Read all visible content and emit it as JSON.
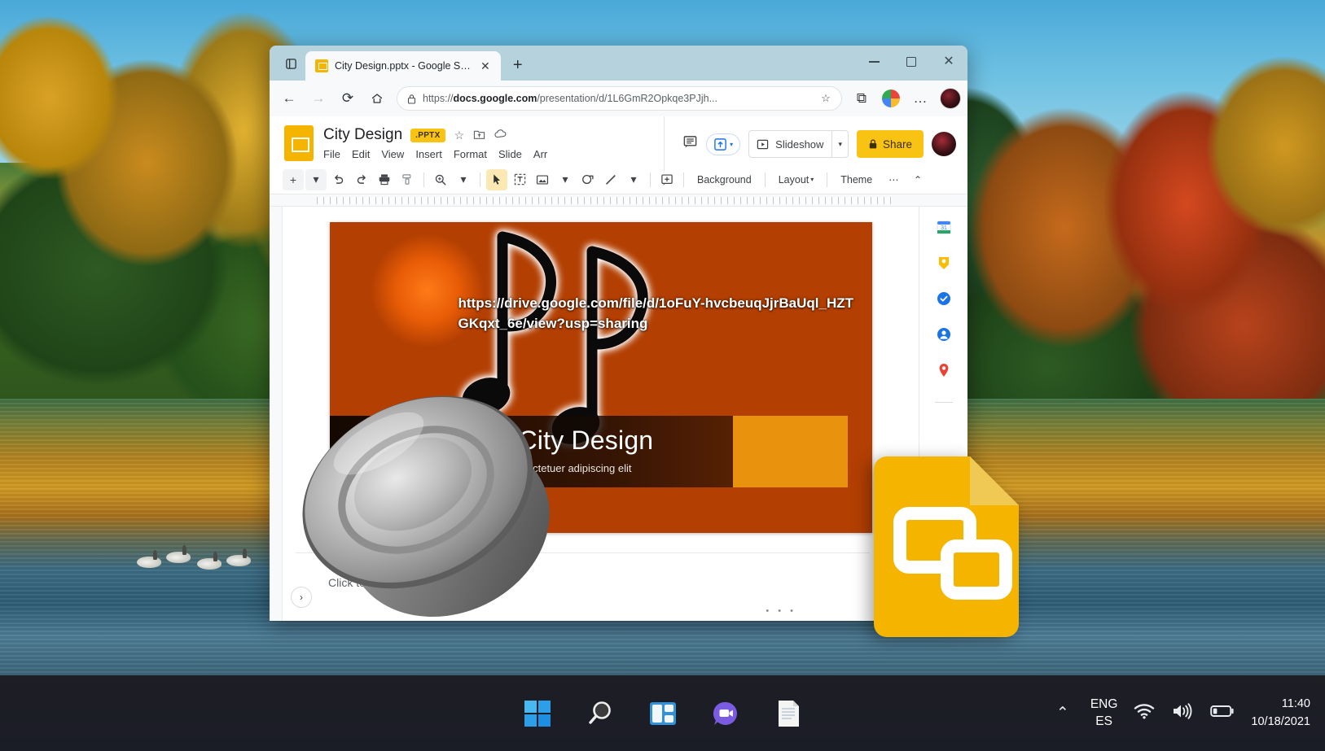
{
  "browser": {
    "tab": {
      "title": "City Design.pptx - Google Slides",
      "favicon": "slides-favicon",
      "close_label": "✕"
    },
    "newtab_label": "+",
    "nav": {
      "back": "←",
      "forward": "→",
      "reload": "⟳",
      "home": "⌂"
    },
    "omnibox": {
      "lock_icon": "lock-icon",
      "url_prefix": "https://",
      "url_domain": "docs.google.com",
      "url_path": "/presentation/d/1L6GmR2Opkqe3PJjh...",
      "favorite_icon": "☆",
      "collections_icon": "⧉",
      "extensions_icon": "extensions-icon",
      "settings_icon": "…"
    },
    "window_controls": {
      "minimize": "minimize",
      "maximize": "maximize",
      "close": "✕"
    }
  },
  "slides": {
    "doc_title": "City Design",
    "file_badge": ".PPTX",
    "title_icons": [
      "star-icon",
      "move-to-folder-icon",
      "cloud-saved-icon"
    ],
    "menus": [
      "File",
      "Edit",
      "View",
      "Insert",
      "Format",
      "Slide",
      "Arr"
    ],
    "header_actions": {
      "comment_icon": "comment-icon",
      "present_upload_icon": "present-to-meeting-icon",
      "slideshow_label": "Slideshow",
      "slideshow_caret": "▾",
      "share_label": "Share",
      "share_lock_icon": "lock-icon",
      "avatar": "user-avatar"
    },
    "toolbar": {
      "new_slide": "+",
      "new_slide_caret": "▾",
      "undo": "↶",
      "redo": "↷",
      "print": "print-icon",
      "paint_format": "paint-format-icon",
      "zoom": "zoom-icon",
      "zoom_caret": "▾",
      "select": "cursor-icon",
      "textbox": "textbox-icon",
      "image": "image-icon",
      "image_caret": "▾",
      "shape": "shape-icon",
      "line": "line-icon",
      "line_caret": "▾",
      "comment": "add-comment-icon",
      "background_label": "Background",
      "layout_label": "Layout",
      "layout_caret": "▾",
      "theme_label": "Theme",
      "more_label": "⋯",
      "collapse": "⌃"
    },
    "slide": {
      "url_text": "https://drive.google.com/file/d/1oFuY-hvcbeuqJjrBaUql_HZTGKqxt_6e/view?usp=sharing",
      "title": "City Design",
      "subtitle": "or sit amet, consectetuer adipiscing elit",
      "handle_dots": "• • •",
      "audio_object": "speaker-audio-icon",
      "music_graphic": "music-notes-graphic"
    },
    "notes": {
      "placeholder": "Click to",
      "expand_icon": "›"
    },
    "side_panel": {
      "items": [
        "google-calendar-icon",
        "google-keep-icon",
        "google-tasks-icon",
        "google-contacts-icon",
        "google-maps-icon"
      ]
    }
  },
  "overlay": {
    "app_logo": "google-slides-logo"
  },
  "taskbar": {
    "items": [
      {
        "name": "start-button",
        "label": "Start"
      },
      {
        "name": "search-button",
        "label": "Search"
      },
      {
        "name": "task-view-button",
        "label": "Task View"
      },
      {
        "name": "chat-button",
        "label": "Chat"
      },
      {
        "name": "notes-app-button",
        "label": "Notes"
      }
    ],
    "tray": {
      "chevron": "⌃",
      "lang_primary": "ENG",
      "lang_secondary": "ES",
      "wifi_icon": "wifi-icon",
      "volume_icon": "volume-icon",
      "battery_icon": "battery-icon",
      "time": "11:40",
      "date": "10/18/2021"
    }
  },
  "colors": {
    "slides_yellow": "#f4b400",
    "share_yellow": "#f9c313",
    "accent_orange": "#e8920e",
    "taskbar_bg": "#181922"
  }
}
